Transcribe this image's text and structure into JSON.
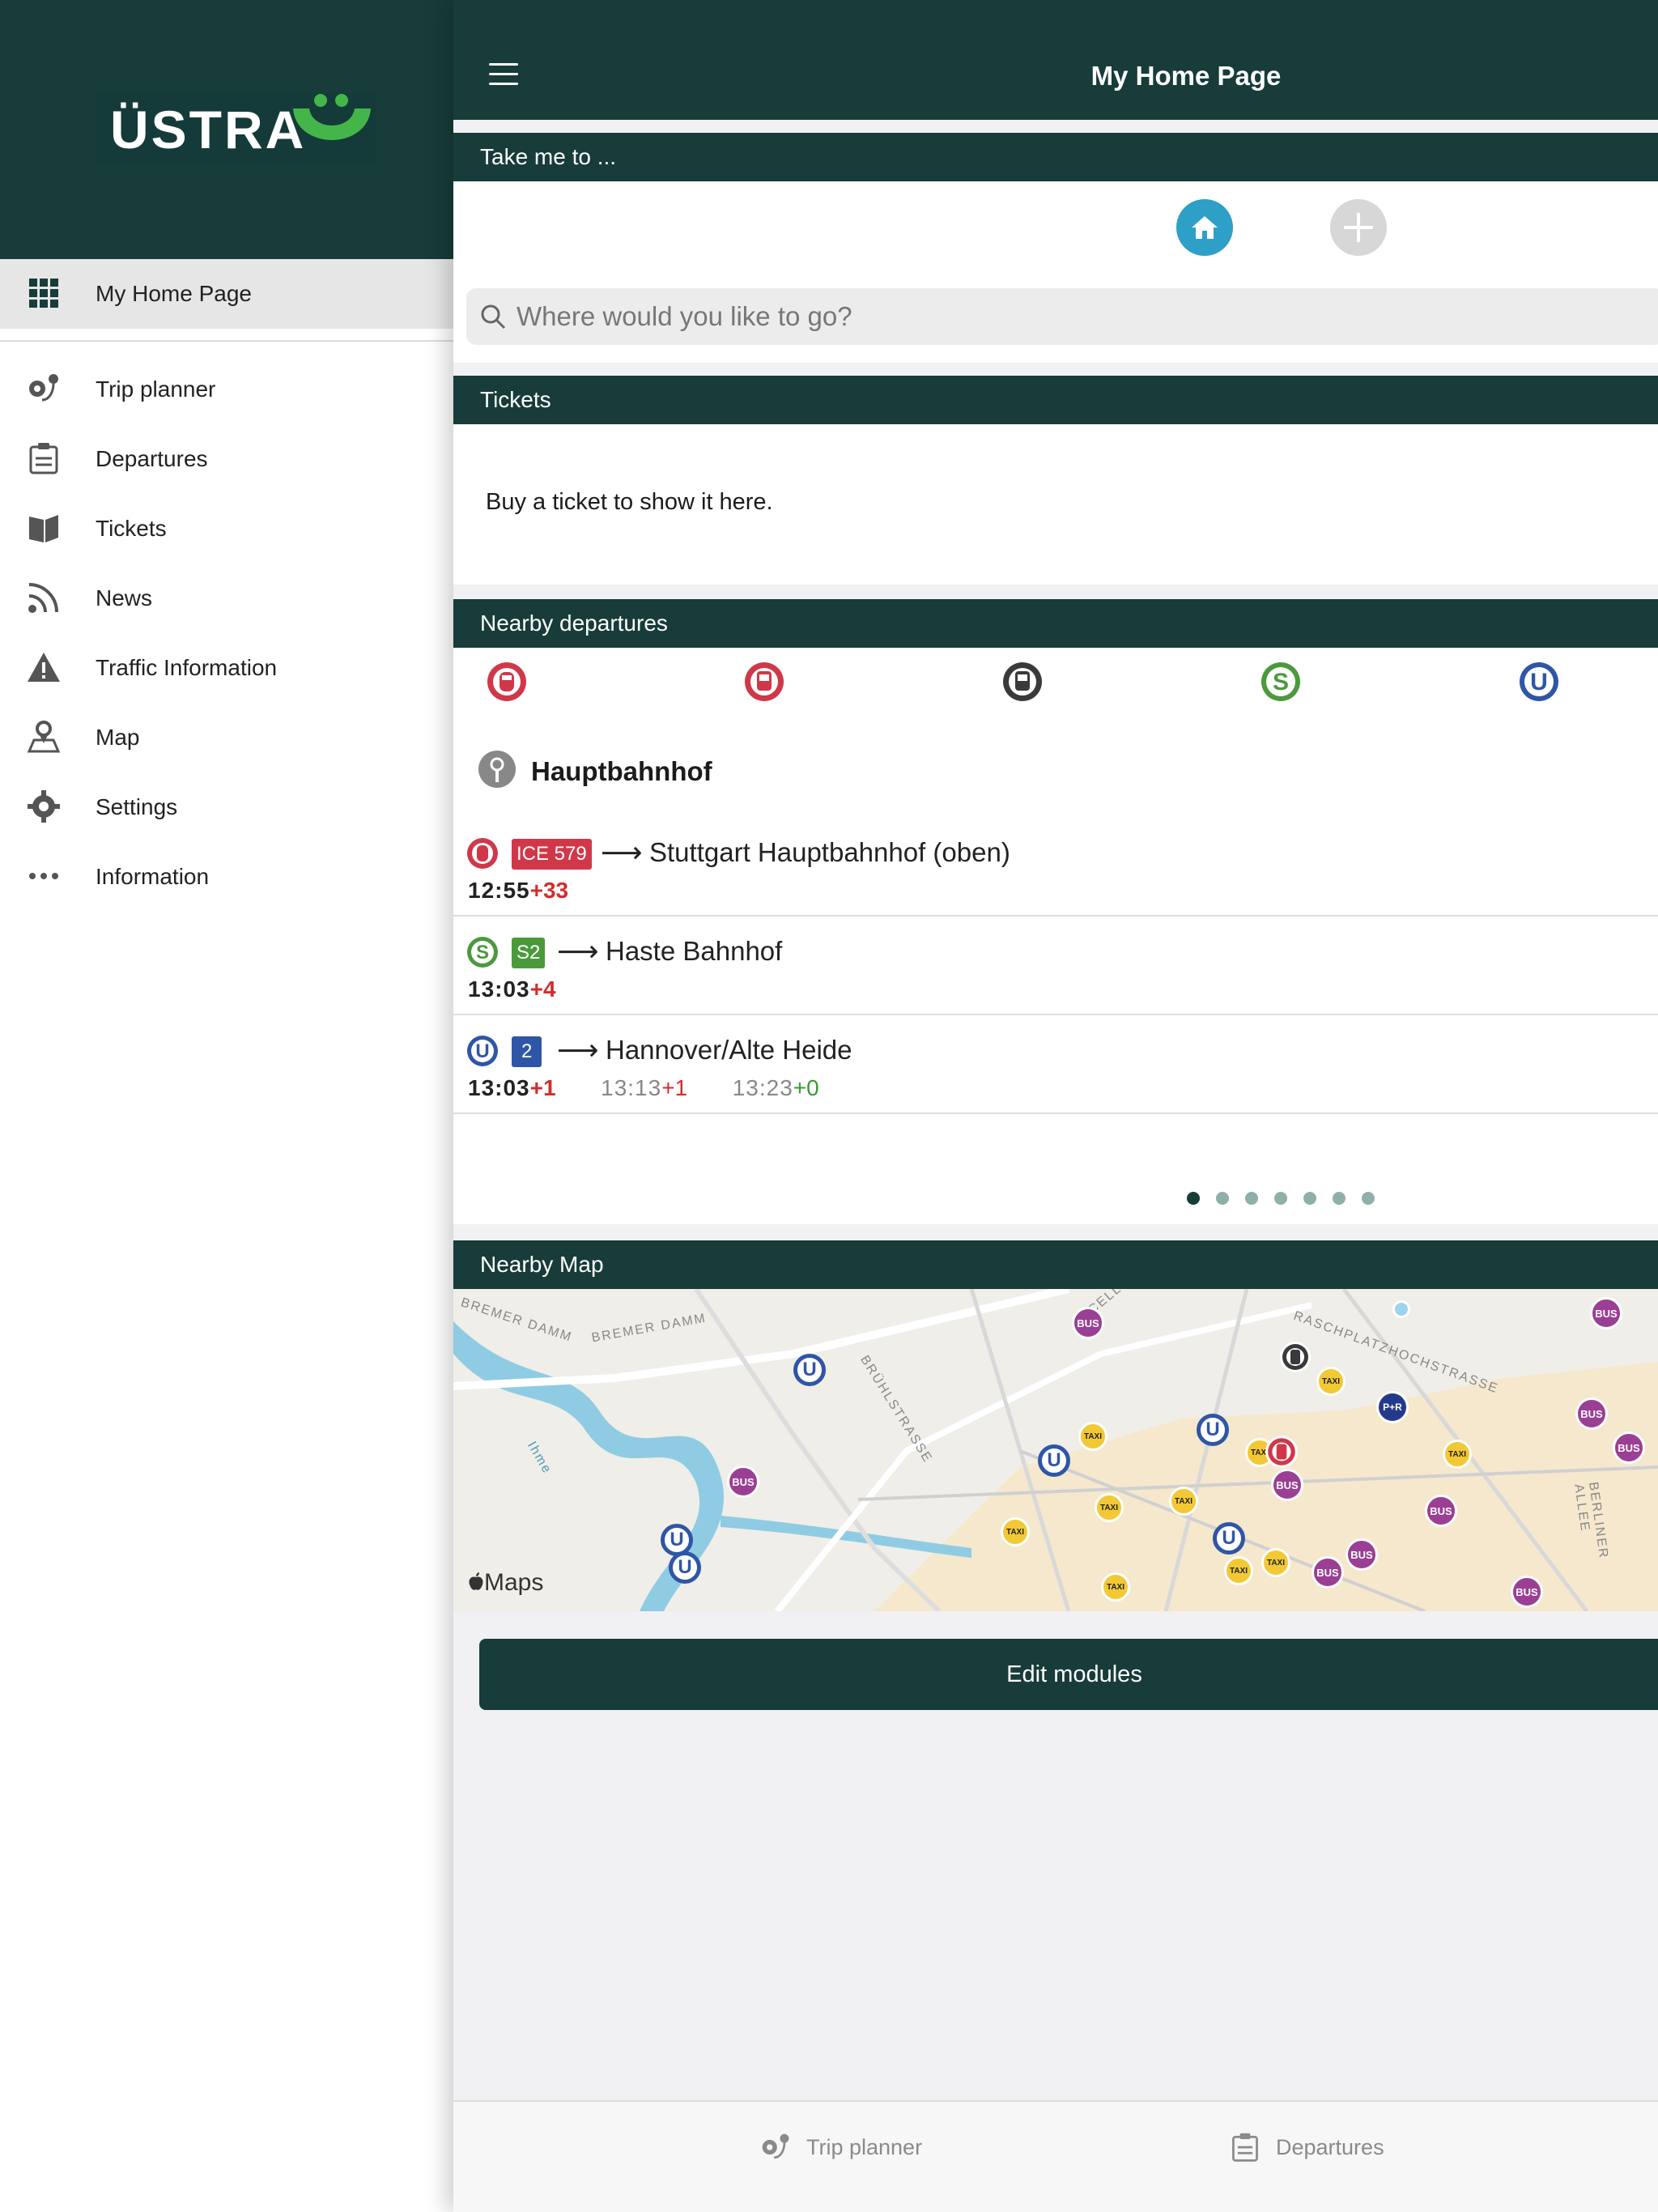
{
  "brand": {
    "logo_text": "ÜSTRA"
  },
  "header": {
    "title": "My Home Page"
  },
  "sidebar": {
    "items": [
      {
        "label": "My Home Page",
        "icon": "grid-icon"
      },
      {
        "label": "Trip planner",
        "icon": "trip-planner-icon"
      },
      {
        "label": "Departures",
        "icon": "departures-icon"
      },
      {
        "label": "Tickets",
        "icon": "tickets-icon"
      },
      {
        "label": "News",
        "icon": "rss-icon"
      },
      {
        "label": "Traffic Information",
        "icon": "warning-icon"
      },
      {
        "label": "Map",
        "icon": "map-icon"
      },
      {
        "label": "Settings",
        "icon": "gear-icon"
      },
      {
        "label": "Information",
        "icon": "more-icon"
      }
    ]
  },
  "take_me_to": {
    "title": "Take me to ...",
    "search_placeholder": "Where would you like to go?"
  },
  "tickets": {
    "title": "Tickets",
    "empty_text": "Buy a ticket to show it here."
  },
  "nearby_departures": {
    "title": "Nearby departures",
    "stop": "Hauptbahnhof",
    "rows": [
      {
        "line": "ICE 579",
        "destination": "Stuttgart Hauptbahnhof (oben)",
        "time": "12:55",
        "delay": "+33"
      },
      {
        "line": "S2",
        "destination": "Haste Bahnhof",
        "time": "13:03",
        "delay": "+4"
      },
      {
        "line": "2",
        "destination": "Hannover/Alte Heide",
        "time": "13:03",
        "delay": "+1",
        "next1_time": "13:13",
        "next1_delay": "+1",
        "next2_time": "13:23",
        "next2_delay": "+0"
      }
    ],
    "page_count": 7,
    "active_page": 1
  },
  "nearby_map": {
    "title": "Nearby Map",
    "attribution": "Maps",
    "labels": [
      "BREMER DAMM",
      "BREMER DAMM",
      "BRÜHLSTRASSE",
      "Ihme",
      "RASCHPLATZHOCHSTRASSE",
      "BERLINER ALLEE",
      "CELLE"
    ],
    "pin_labels": {
      "bus": "BUS",
      "taxi": "TAXI",
      "park_ride": "P+R",
      "ubahn": "U"
    }
  },
  "actions": {
    "edit_modules": "Edit modules"
  },
  "tabbar": [
    {
      "label": "Trip planner"
    },
    {
      "label": "Departures"
    }
  ],
  "colors": {
    "primary": "#173c3a",
    "ice_red": "#d0384a",
    "sbahn_green": "#4a9a3c",
    "ubahn_blue": "#2f56a6",
    "delay_red": "#d42c2c",
    "ontime_green": "#3a9a34"
  }
}
